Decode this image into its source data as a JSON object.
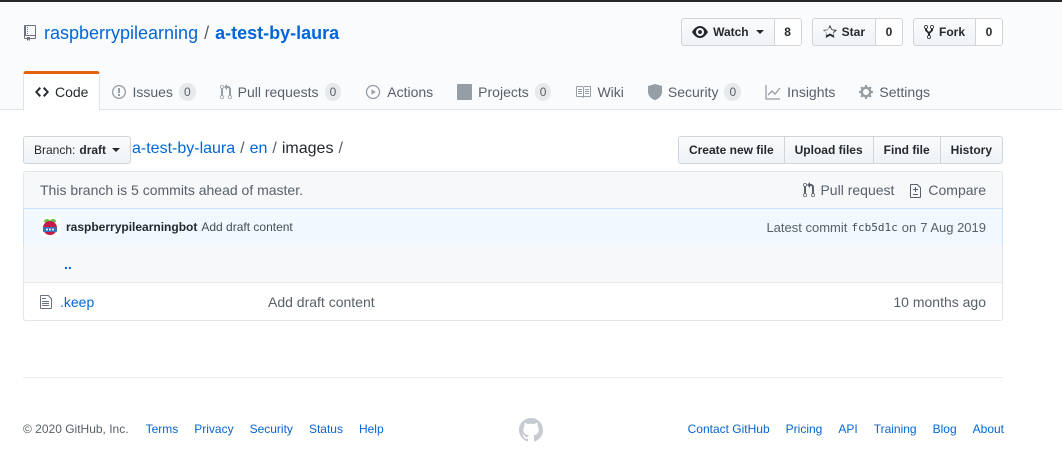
{
  "repo": {
    "owner": "raspberrypilearning",
    "separator": "/",
    "name": "a-test-by-laura"
  },
  "actions": {
    "watch": {
      "label": "Watch",
      "count": "8"
    },
    "star": {
      "label": "Star",
      "count": "0"
    },
    "fork": {
      "label": "Fork",
      "count": "0"
    }
  },
  "tabs": [
    {
      "label": "Code",
      "counter": ""
    },
    {
      "label": "Issues",
      "counter": "0"
    },
    {
      "label": "Pull requests",
      "counter": "0"
    },
    {
      "label": "Actions",
      "counter": ""
    },
    {
      "label": "Projects",
      "counter": "0"
    },
    {
      "label": "Wiki",
      "counter": ""
    },
    {
      "label": "Security",
      "counter": "0"
    },
    {
      "label": "Insights",
      "counter": ""
    },
    {
      "label": "Settings",
      "counter": ""
    }
  ],
  "branch": {
    "prefix": "Branch:",
    "name": "draft"
  },
  "breadcrumb": {
    "repo": "a-test-by-laura",
    "dir1": "en",
    "current": "images",
    "slash": "/"
  },
  "file_nav": {
    "create": "Create new file",
    "upload": "Upload files",
    "find": "Find file",
    "history": "History"
  },
  "branch_info": {
    "text": "This branch is 5 commits ahead of master.",
    "pull_request": "Pull request",
    "compare": "Compare"
  },
  "commit": {
    "author": "raspberrypilearningbot",
    "message": "Add draft content",
    "latest_label": "Latest commit",
    "sha": "fcb5d1c",
    "on_label": "on",
    "date": "7 Aug 2019"
  },
  "files": {
    "up": "..",
    "rows": [
      {
        "name": ".keep",
        "message": "Add draft content",
        "age": "10 months ago"
      }
    ]
  },
  "footer": {
    "copyright": "© 2020 GitHub, Inc.",
    "left_links": [
      "Terms",
      "Privacy",
      "Security",
      "Status",
      "Help"
    ],
    "right_links": [
      "Contact GitHub",
      "Pricing",
      "API",
      "Training",
      "Blog",
      "About"
    ]
  }
}
